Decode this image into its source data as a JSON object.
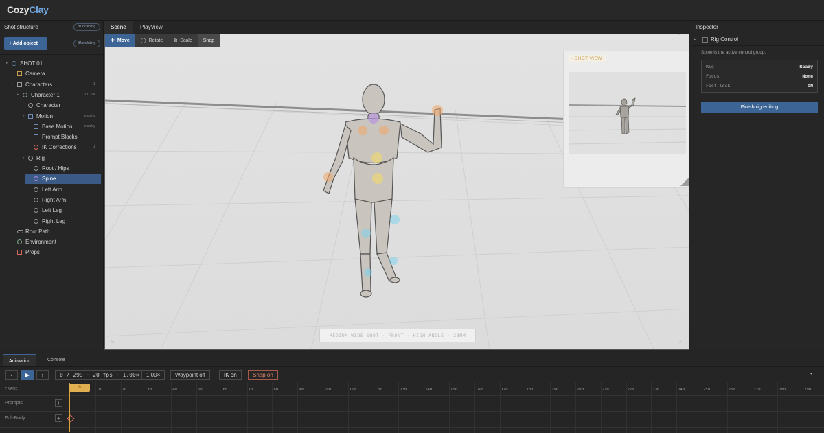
{
  "app": {
    "logo_a": "Cozy",
    "logo_b": "Clay"
  },
  "left": {
    "title": "Shot structure",
    "pill1": "Blocking",
    "pill2": "Blocking",
    "add_button": "Add object",
    "tree": [
      {
        "label": "SHOT 01",
        "tag": ""
      },
      {
        "label": "Camera",
        "tag": ""
      },
      {
        "label": "Characters",
        "tag": "1"
      },
      {
        "label": "Character 1",
        "tag": "IK ON"
      },
      {
        "label": "Character",
        "tag": ""
      },
      {
        "label": "Motion",
        "tag": "empty"
      },
      {
        "label": "Base Motion",
        "tag": "empty"
      },
      {
        "label": "Prompt Blocks",
        "tag": ""
      },
      {
        "label": "IK Corrections",
        "tag": "1"
      },
      {
        "label": "Rig",
        "tag": ""
      },
      {
        "label": "Root / Hips",
        "tag": ""
      },
      {
        "label": "Spine",
        "tag": ""
      },
      {
        "label": "Left Arm",
        "tag": ""
      },
      {
        "label": "Right Arm",
        "tag": ""
      },
      {
        "label": "Left Leg",
        "tag": ""
      },
      {
        "label": "Right Leg",
        "tag": ""
      },
      {
        "label": "Root Path",
        "tag": ""
      },
      {
        "label": "Environment",
        "tag": ""
      },
      {
        "label": "Props",
        "tag": ""
      }
    ]
  },
  "viewport": {
    "tabs": [
      "Scene",
      "PlayView"
    ],
    "tools": {
      "move": "Move",
      "rotate": "Rotate",
      "scale": "Scale",
      "snap": "Snap"
    },
    "shot_caption": "MEDIUM-WIDE SHOT · FRONT · HIGH ANGLE · 28MM",
    "shot_view_label": "· SHOT VIEW"
  },
  "inspector": {
    "title": "Inspector",
    "rig_control": "Rig Control",
    "desc": "Spine is the active control group.",
    "rows": [
      {
        "key": "Rig",
        "value": "Ready"
      },
      {
        "key": "Focus",
        "value": "None"
      },
      {
        "key": "Foot lock",
        "value": "ON"
      }
    ],
    "finish": "Finish rig editing"
  },
  "bottom": {
    "tabs": [
      "Animation",
      "Console"
    ],
    "prev": "‹",
    "play": "▶",
    "next": "›",
    "frame_readout": "0 / 299 · 20 fps · 1.00×",
    "speed": "1.00×",
    "waypoint": "Waypoint off",
    "ik": "IK on",
    "snap": "Snap on",
    "more": "•",
    "frame_label": "FRAME",
    "playhead_frame": "0",
    "tracks": [
      "Prompts",
      "Full-Body"
    ],
    "ticks": [
      "10",
      "20",
      "30",
      "40",
      "50",
      "60",
      "70",
      "80",
      "90",
      "100",
      "110",
      "120",
      "130",
      "140",
      "150",
      "160",
      "170",
      "180",
      "190",
      "200",
      "210",
      "220",
      "230",
      "240",
      "250",
      "260",
      "270",
      "280",
      "290"
    ]
  },
  "colors": {
    "accent": "#3c6495",
    "playhead": "#e0b050",
    "snap": "#e88a70"
  }
}
